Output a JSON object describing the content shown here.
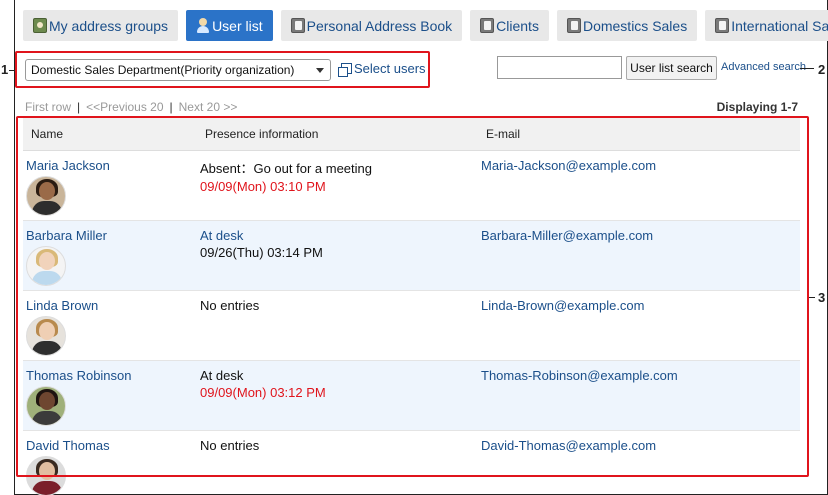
{
  "tabs": [
    {
      "label": "My address groups",
      "icon": "group-book-icon",
      "active": false
    },
    {
      "label": "User list",
      "icon": "user-icon",
      "active": true
    },
    {
      "label": "Personal Address Book",
      "icon": "address-book-icon",
      "active": false
    },
    {
      "label": "Clients",
      "icon": "address-book-icon",
      "active": false
    },
    {
      "label": "Domestics Sales",
      "icon": "address-book-icon",
      "active": false
    },
    {
      "label": "International Sales",
      "icon": "address-book-icon",
      "active": false
    }
  ],
  "toolbar": {
    "organization_value": "Domestic Sales Department(Priority organization)",
    "select_users_label": "Select users",
    "search_value": "",
    "search_button_label": "User list search",
    "advanced_search_label": "Advanced search"
  },
  "callouts": {
    "one": "1",
    "two": "2",
    "three": "3"
  },
  "pager": {
    "first": "First row",
    "sep": "|",
    "prev": "<<Previous 20",
    "next": "Next 20 >>",
    "displaying": "Displaying 1-7"
  },
  "table": {
    "headers": {
      "name": "Name",
      "presence": "Presence information",
      "email": "E-mail"
    },
    "rows": [
      {
        "name": "Maria Jackson",
        "status": "Absent：Go out for a meeting",
        "status_link": false,
        "time": "09/09(Mon) 03:10 PM",
        "time_red": true,
        "email": "Maria-Jackson@example.com"
      },
      {
        "name": "Barbara Miller",
        "status": "At desk",
        "status_link": true,
        "time": "09/26(Thu) 03:14 PM",
        "time_red": false,
        "email": "Barbara-Miller@example.com"
      },
      {
        "name": "Linda Brown",
        "status": "No entries",
        "status_link": false,
        "time": "",
        "time_red": false,
        "email": "Linda-Brown@example.com"
      },
      {
        "name": "Thomas Robinson",
        "status": "At desk",
        "status_link": false,
        "time": "09/09(Mon) 03:12 PM",
        "time_red": true,
        "email": "Thomas-Robinson@example.com"
      },
      {
        "name": "David Thomas",
        "status": "No entries",
        "status_link": false,
        "time": "",
        "time_red": false,
        "email": "David-Thomas@example.com"
      }
    ]
  },
  "colors": {
    "accent": "#2b73c8",
    "link": "#1b4f8a",
    "red": "#e0141c",
    "alt_row": "#eef5fd"
  }
}
